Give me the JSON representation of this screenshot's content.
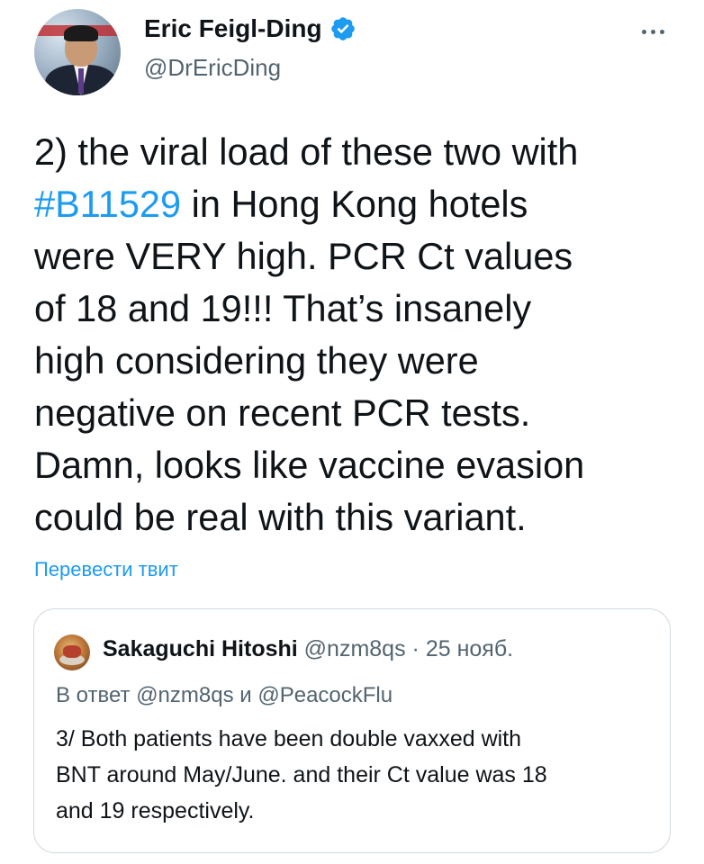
{
  "author": {
    "display_name": "Eric Feigl-Ding",
    "handle": "@DrEricDing",
    "verified_icon": "verified-badge-icon",
    "verified_color": "#1d9bf0"
  },
  "more_icon": "more-horizontal-icon",
  "tweet": {
    "lines": [
      {
        "pre": "2) the viral load of these two with",
        "tag": "",
        "post": ""
      },
      {
        "pre": "",
        "tag": "#B11529",
        "post": " in Hong Kong hotels"
      },
      {
        "pre": "were VERY high. PCR Ct values",
        "tag": "",
        "post": ""
      },
      {
        "pre": "of 18 and 19!!! That’s insanely",
        "tag": "",
        "post": ""
      },
      {
        "pre": "high considering they were",
        "tag": "",
        "post": ""
      },
      {
        "pre": "negative on recent PCR tests.",
        "tag": "",
        "post": ""
      },
      {
        "pre": "Damn, looks like vaccine evasion",
        "tag": "",
        "post": ""
      },
      {
        "pre": "could be real with this variant.",
        "tag": "",
        "post": ""
      }
    ],
    "translate_link": "Перевести твит",
    "link_color": "#1d9bf0"
  },
  "quote": {
    "display_name": "Sakaguchi Hitoshi",
    "handle": "@nzm8qs",
    "separator": " · ",
    "date": "25 нояб.",
    "reply_prefix": "В ответ ",
    "reply_mention_1": "@nzm8qs",
    "reply_joiner": " и ",
    "reply_mention_2": "@PeacockFlu",
    "text_lines": [
      "3/ Both patients have been double vaxxed with",
      "BNT around May/June. and their Ct value was 18",
      "and 19 respectively."
    ]
  }
}
